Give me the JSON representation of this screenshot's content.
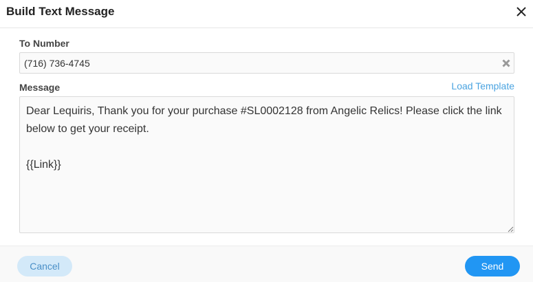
{
  "dialog": {
    "title": "Build Text Message"
  },
  "form": {
    "to_label": "To Number",
    "to_value": "(716) 736-4745",
    "message_label": "Message",
    "load_template_label": "Load Template",
    "message_text": "Dear Lequiris, Thank you for your purchase #SL0002128 from Angelic Relics! Please click the link below to get your receipt.\n\n{{Link}}"
  },
  "footer": {
    "cancel_label": "Cancel",
    "send_label": "Send"
  },
  "colors": {
    "accent": "#2196f3",
    "link": "#4aa3e0",
    "cancel_bg": "#d3e9f9"
  },
  "icons": {
    "close": "close-icon",
    "clear": "clear-icon",
    "resize": "resize-grip-icon"
  }
}
